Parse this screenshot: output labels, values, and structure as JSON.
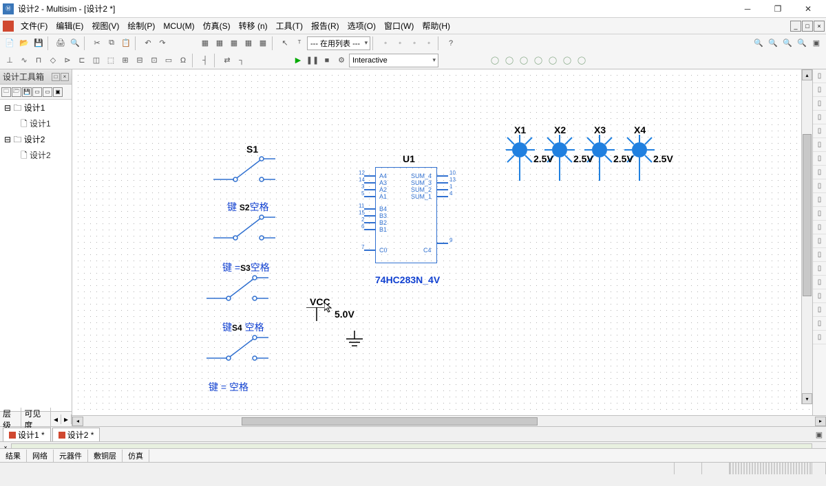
{
  "window": {
    "title": "设计2 - Multisim - [设计2 *]"
  },
  "menu": {
    "items": [
      "文件(F)",
      "编辑(E)",
      "视图(V)",
      "绘制(P)",
      "MCU(M)",
      "仿真(S)",
      "转移 (n)",
      "工具(T)",
      "报告(R)",
      "选项(O)",
      "窗口(W)",
      "帮助(H)"
    ]
  },
  "toolbar": {
    "combo1": "--- 在用列表 ---",
    "combo2": "Interactive"
  },
  "sidebar": {
    "title": "设计工具箱",
    "tree": [
      {
        "label": "设计1",
        "child": "设计1"
      },
      {
        "label": "设计2",
        "child": "设计2"
      }
    ],
    "bottom": [
      "层级",
      "可见度"
    ]
  },
  "tabs": [
    "设计1 *",
    "设计2 *"
  ],
  "bottomtabs": [
    "结果",
    "网络",
    "元器件",
    "敷铜层",
    "仿真"
  ],
  "chart_data": {
    "type": "schematic",
    "components": [
      {
        "ref": "S1",
        "type": "SPDT switch",
        "label": "S1",
        "key_binding": "键 = 空格"
      },
      {
        "ref": "S2",
        "type": "SPDT switch",
        "label": "S2",
        "key_binding": "键 = 空格"
      },
      {
        "ref": "S3",
        "type": "SPDT switch",
        "label": "S3",
        "key_binding": "键 = 空格"
      },
      {
        "ref": "S4",
        "type": "SPDT switch",
        "label": "S4",
        "key_binding": "键 = 空格"
      },
      {
        "ref": "U1",
        "type": "IC",
        "part": "74HC283N_4V",
        "pins_left": [
          {
            "num": "12",
            "name": "A4"
          },
          {
            "num": "14",
            "name": "A3"
          },
          {
            "num": "3",
            "name": "A2"
          },
          {
            "num": "5",
            "name": "A1"
          },
          {
            "num": "11",
            "name": "B4"
          },
          {
            "num": "15",
            "name": "B3"
          },
          {
            "num": "2",
            "name": "B2"
          },
          {
            "num": "6",
            "name": "B1"
          },
          {
            "num": "7",
            "name": "C0"
          }
        ],
        "pins_right": [
          {
            "num": "10",
            "name": "SUM_4"
          },
          {
            "num": "13",
            "name": "SUM_3"
          },
          {
            "num": "1",
            "name": "SUM_2"
          },
          {
            "num": "4",
            "name": "SUM_1"
          },
          {
            "num": "9",
            "name": "C4"
          }
        ]
      },
      {
        "ref": "VCC",
        "type": "power",
        "value": "5.0V"
      },
      {
        "ref": "GND",
        "type": "ground"
      },
      {
        "ref": "X1",
        "type": "probe-indicator",
        "value": "2.5V"
      },
      {
        "ref": "X2",
        "type": "probe-indicator",
        "value": "2.5V"
      },
      {
        "ref": "X3",
        "type": "probe-indicator",
        "value": "2.5V"
      },
      {
        "ref": "X4",
        "type": "probe-indicator",
        "value": "2.5V"
      }
    ]
  },
  "labels": {
    "s1": "S1",
    "s2": "S2",
    "s3": "S3",
    "s4": "S4",
    "key": "键 = 空格",
    "key2": "键 =空格",
    "key3": "键= 空格",
    "u1": "U1",
    "chip": "74HC283N_4V",
    "vcc": "VCC",
    "vcc_val": "5.0V",
    "x1": "X1",
    "x2": "X2",
    "x3": "X3",
    "x4": "X4",
    "pv": "2.5V",
    "pins": {
      "a4": "A4",
      "a3": "A3",
      "a2": "A2",
      "a1": "A1",
      "b4": "B4",
      "b3": "B3",
      "b2": "B2",
      "b1": "B1",
      "c0": "C0",
      "s4p": "SUM_4",
      "s3p": "SUM_3",
      "s2p": "SUM_2",
      "s1p": "SUM_1",
      "c4": "C4"
    },
    "pn": {
      "p12": "12",
      "p14": "14",
      "p3": "3",
      "p5": "5",
      "p11": "11",
      "p15": "15",
      "p2": "2",
      "p6": "6",
      "p7": "7",
      "p10": "10",
      "p13": "13",
      "p1": "1",
      "p4": "4",
      "p9": "9"
    }
  }
}
